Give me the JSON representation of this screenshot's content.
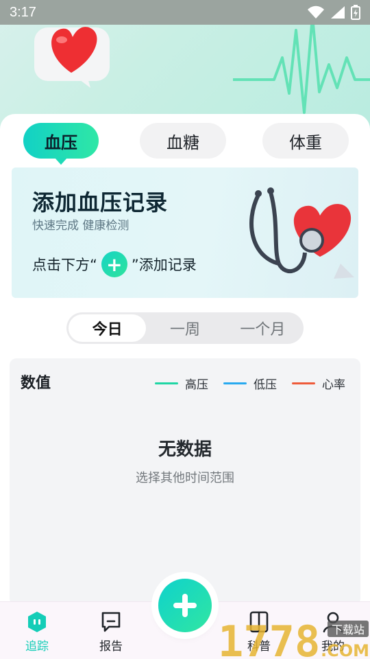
{
  "status_bar": {
    "time": "3:17"
  },
  "tabs": [
    {
      "label": "血压",
      "active": true
    },
    {
      "label": "血糖",
      "active": false
    },
    {
      "label": "体重",
      "active": false
    }
  ],
  "banner": {
    "title": "添加血压记录",
    "subtitle": "快速完成  健康检测",
    "hint_prefix": "点击下方“",
    "hint_suffix": "”添加记录"
  },
  "segment": {
    "items": [
      {
        "label": "今日",
        "active": true
      },
      {
        "label": "一周",
        "active": false
      },
      {
        "label": "一个月",
        "active": false
      }
    ]
  },
  "panel": {
    "title": "数值",
    "legend": [
      {
        "label": "高压",
        "color": "#1fd6a4"
      },
      {
        "label": "低压",
        "color": "#27a9ef"
      },
      {
        "label": "心率",
        "color": "#ee5b3a"
      }
    ],
    "empty_title": "无数据",
    "empty_subtitle": "选择其他时间范围"
  },
  "bottom_nav": {
    "items": [
      {
        "label": "追踪",
        "icon": "tracking-icon",
        "active": true
      },
      {
        "label": "报告",
        "icon": "report-icon",
        "active": false
      },
      {
        "label": "科普",
        "icon": "book-icon",
        "active": false
      },
      {
        "label": "我的",
        "icon": "profile-icon",
        "active": false
      }
    ],
    "fab_icon": "plus-icon"
  },
  "watermark": {
    "text": "1778",
    "subtext": "下载站",
    "domain": ".COM"
  },
  "colors": {
    "accent": "#14cdb7",
    "accent_2": "#2fe7a6"
  }
}
